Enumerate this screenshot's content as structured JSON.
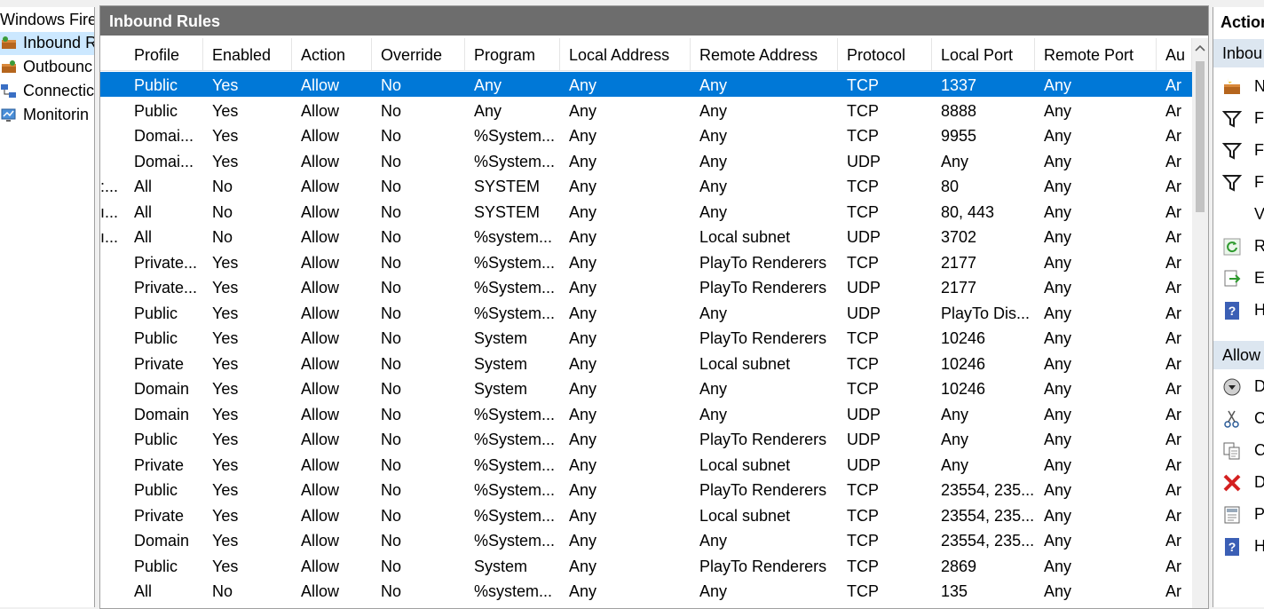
{
  "tree": {
    "root_label": "Windows Fire",
    "items": [
      {
        "label": "Inbound R",
        "icon": "inbound-rules-icon",
        "selected": true
      },
      {
        "label": "Outbounc",
        "icon": "outbound-rules-icon",
        "selected": false
      },
      {
        "label": "Connectic",
        "icon": "connection-security-icon",
        "selected": false
      },
      {
        "label": "Monitorin",
        "icon": "monitoring-icon",
        "selected": false
      }
    ]
  },
  "center": {
    "title": "Inbound Rules",
    "columns": [
      "Profile",
      "Enabled",
      "Action",
      "Override",
      "Program",
      "Local Address",
      "Remote Address",
      "Protocol",
      "Local Port",
      "Remote Port",
      "Au"
    ],
    "rows": [
      {
        "prefix": "",
        "cells": [
          "Public",
          "Yes",
          "Allow",
          "No",
          "Any",
          "Any",
          "Any",
          "TCP",
          "1337",
          "Any",
          "Ar"
        ],
        "selected": true
      },
      {
        "prefix": "",
        "cells": [
          "Public",
          "Yes",
          "Allow",
          "No",
          "Any",
          "Any",
          "Any",
          "TCP",
          "8888",
          "Any",
          "Ar"
        ]
      },
      {
        "prefix": "",
        "cells": [
          "Domai...",
          "Yes",
          "Allow",
          "No",
          "%System...",
          "Any",
          "Any",
          "TCP",
          "9955",
          "Any",
          "Ar"
        ]
      },
      {
        "prefix": "",
        "cells": [
          "Domai...",
          "Yes",
          "Allow",
          "No",
          "%System...",
          "Any",
          "Any",
          "UDP",
          "Any",
          "Any",
          "Ar"
        ]
      },
      {
        "prefix": ":...",
        "cells": [
          "All",
          "No",
          "Allow",
          "No",
          "SYSTEM",
          "Any",
          "Any",
          "TCP",
          "80",
          "Any",
          "Ar"
        ]
      },
      {
        "prefix": "ı...",
        "cells": [
          "All",
          "No",
          "Allow",
          "No",
          "SYSTEM",
          "Any",
          "Any",
          "TCP",
          "80, 443",
          "Any",
          "Ar"
        ]
      },
      {
        "prefix": "ı...",
        "cells": [
          "All",
          "No",
          "Allow",
          "No",
          "%system...",
          "Any",
          "Local subnet",
          "UDP",
          "3702",
          "Any",
          "Ar"
        ]
      },
      {
        "prefix": "",
        "cells": [
          "Private...",
          "Yes",
          "Allow",
          "No",
          "%System...",
          "Any",
          "PlayTo Renderers",
          "TCP",
          "2177",
          "Any",
          "Ar"
        ]
      },
      {
        "prefix": "",
        "cells": [
          "Private...",
          "Yes",
          "Allow",
          "No",
          "%System...",
          "Any",
          "PlayTo Renderers",
          "UDP",
          "2177",
          "Any",
          "Ar"
        ]
      },
      {
        "prefix": "",
        "cells": [
          "Public",
          "Yes",
          "Allow",
          "No",
          "%System...",
          "Any",
          "Any",
          "UDP",
          "PlayTo Dis...",
          "Any",
          "Ar"
        ]
      },
      {
        "prefix": "",
        "cells": [
          "Public",
          "Yes",
          "Allow",
          "No",
          "System",
          "Any",
          "PlayTo Renderers",
          "TCP",
          "10246",
          "Any",
          "Ar"
        ]
      },
      {
        "prefix": "",
        "cells": [
          "Private",
          "Yes",
          "Allow",
          "No",
          "System",
          "Any",
          "Local subnet",
          "TCP",
          "10246",
          "Any",
          "Ar"
        ]
      },
      {
        "prefix": "",
        "cells": [
          "Domain",
          "Yes",
          "Allow",
          "No",
          "System",
          "Any",
          "Any",
          "TCP",
          "10246",
          "Any",
          "Ar"
        ]
      },
      {
        "prefix": "",
        "cells": [
          "Domain",
          "Yes",
          "Allow",
          "No",
          "%System...",
          "Any",
          "Any",
          "UDP",
          "Any",
          "Any",
          "Ar"
        ]
      },
      {
        "prefix": "",
        "cells": [
          "Public",
          "Yes",
          "Allow",
          "No",
          "%System...",
          "Any",
          "PlayTo Renderers",
          "UDP",
          "Any",
          "Any",
          "Ar"
        ]
      },
      {
        "prefix": "",
        "cells": [
          "Private",
          "Yes",
          "Allow",
          "No",
          "%System...",
          "Any",
          "Local subnet",
          "UDP",
          "Any",
          "Any",
          "Ar"
        ]
      },
      {
        "prefix": "",
        "cells": [
          "Public",
          "Yes",
          "Allow",
          "No",
          "%System...",
          "Any",
          "PlayTo Renderers",
          "TCP",
          "23554, 235...",
          "Any",
          "Ar"
        ]
      },
      {
        "prefix": "",
        "cells": [
          "Private",
          "Yes",
          "Allow",
          "No",
          "%System...",
          "Any",
          "Local subnet",
          "TCP",
          "23554, 235...",
          "Any",
          "Ar"
        ]
      },
      {
        "prefix": "",
        "cells": [
          "Domain",
          "Yes",
          "Allow",
          "No",
          "%System...",
          "Any",
          "Any",
          "TCP",
          "23554, 235...",
          "Any",
          "Ar"
        ]
      },
      {
        "prefix": "",
        "cells": [
          "Public",
          "Yes",
          "Allow",
          "No",
          "System",
          "Any",
          "PlayTo Renderers",
          "TCP",
          "2869",
          "Any",
          "Ar"
        ]
      },
      {
        "prefix": "",
        "cells": [
          "All",
          "No",
          "Allow",
          "No",
          "%system...",
          "Any",
          "Any",
          "TCP",
          "135",
          "Any",
          "Ar"
        ]
      }
    ]
  },
  "actions": {
    "header": "Actior",
    "section1": "Inbou",
    "items1": [
      {
        "label": "N",
        "icon": "new-rule-icon"
      },
      {
        "label": "Fi",
        "icon": "filter-icon"
      },
      {
        "label": "Fi",
        "icon": "filter-icon"
      },
      {
        "label": "Fi",
        "icon": "filter-icon"
      },
      {
        "label": "V",
        "icon": ""
      },
      {
        "label": "R",
        "icon": "refresh-icon"
      },
      {
        "label": "E:",
        "icon": "export-icon"
      },
      {
        "label": "H",
        "icon": "help-icon"
      }
    ],
    "section2": "Allow",
    "items2": [
      {
        "label": "D",
        "icon": "disable-icon"
      },
      {
        "label": "C",
        "icon": "cut-icon"
      },
      {
        "label": "C",
        "icon": "copy-icon"
      },
      {
        "label": "D",
        "icon": "delete-icon"
      },
      {
        "label": "P",
        "icon": "properties-icon"
      },
      {
        "label": "H",
        "icon": "help-icon"
      }
    ]
  },
  "colors": {
    "selection": "#0078d7",
    "title_bar": "#6d6d6d",
    "section_bg": "#dce6f0"
  }
}
